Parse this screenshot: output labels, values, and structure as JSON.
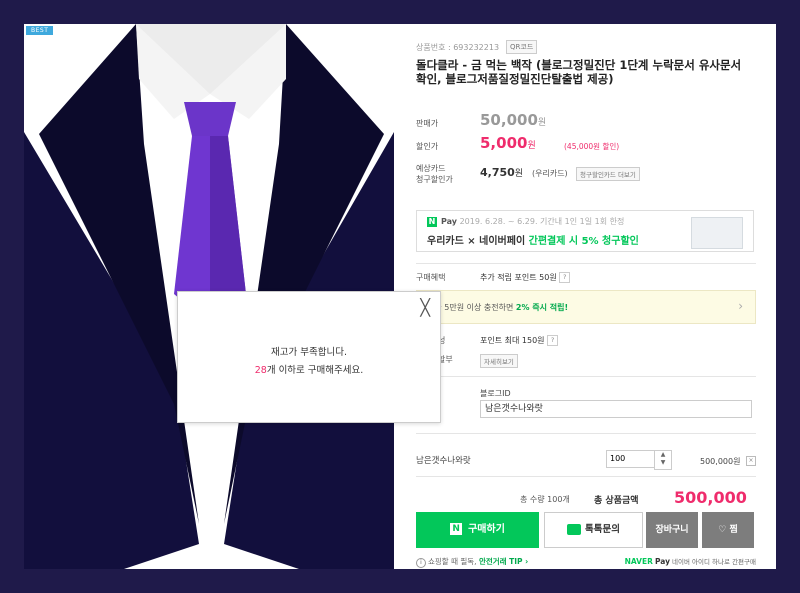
{
  "badge": "BEST",
  "product": {
    "number_label": "상품번호 : 693232213",
    "qr_label": "QR코드",
    "title": "돌다클라 - 금 먹는 백작 (블로그정밀진단 1단계 누락문서 유사문서 확인, 블로그저품질정밀진단탈출법 제공)"
  },
  "price": {
    "sale_label": "판매가",
    "original": "50,000",
    "discount_label": "할인가",
    "discounted": "5,000",
    "won": "원",
    "discount_note": "(45,000원 할인)"
  },
  "card": {
    "label_line1": "예상카드",
    "label_line2": "청구할인가",
    "price": "4,750",
    "won": "원",
    "card_name": "(우리카드)",
    "button": "청구할인카드 더보기"
  },
  "banner": {
    "pay_label": "Pay",
    "n_logo": "N",
    "period": "2019. 6.28. ~ 6.29. 기간내 1인 1일 1회 한정",
    "line2_prefix": "우리카드 × 네이버페이 ",
    "line2_highlight": "간편결제 시 5% 청구할인"
  },
  "benefit": {
    "label": "구매혜택",
    "text": "추가 적립 포인트 50원",
    "q": "?"
  },
  "charge_bar": {
    "text_prefix": "지금 5만원 이상 충전하면 ",
    "text_highlight": "2% 즉시 적립!",
    "chevron": "›"
  },
  "points": {
    "label_partial": "성",
    "text": "포인트 최대 150원",
    "q": "?",
    "installment_label": "할부",
    "detail_button": "자세히보기"
  },
  "option": {
    "field_label": "블로그ID",
    "value": "남은갯수나와랏"
  },
  "selected": {
    "name": "남은갯수나와랏",
    "qty": "100",
    "stepper_up": "▲",
    "stepper_down": "▼",
    "price": "500,000원",
    "remove": "×"
  },
  "summary": {
    "count": "총 수량 100개",
    "total_label": "총 상품금액",
    "total": "500,000",
    "won": "원"
  },
  "buttons": {
    "buy_n": "N",
    "buy": "구매하기",
    "talk": "톡톡문의",
    "cart": "장바구니",
    "wish_heart": "♡",
    "wish": "찜"
  },
  "footer": {
    "info_mark": "i",
    "left_prefix": "쇼핑할 때 필독, ",
    "left_highlight": "안전거래 TIP ›",
    "naver": "NAVER",
    "pay": "Pay",
    "right_text": "네이버 아이디 하나로 간편구매"
  },
  "popup": {
    "close": "╳",
    "line1": "재고가 부족합니다.",
    "count": "28",
    "line2_suffix": "개 이하로 구매해주세요."
  }
}
